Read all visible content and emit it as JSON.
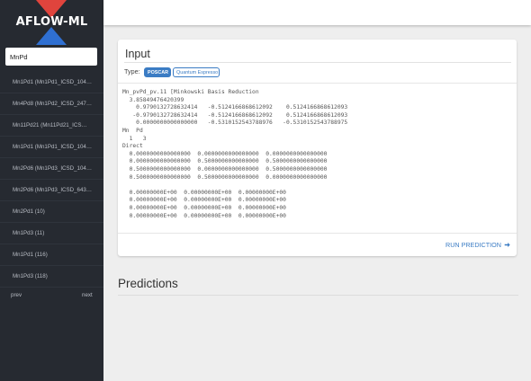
{
  "app": {
    "logo_text": "AFLOW-ML"
  },
  "colors": {
    "sidebar_bg": "#262a31",
    "accent_blue": "#3b7cc4",
    "logo_red": "#e0443d",
    "logo_blue": "#2f6fd1"
  },
  "sidebar": {
    "search_value": "MnPd",
    "items": [
      "Mn1Pd1 (Mn1Pd1_ICSD_104…",
      "Mn4Pd8 (Mn1Pd2_ICSD_247…",
      "Mn11Pd21 (Mn11Pd21_ICS…",
      "Mn1Pd1 (Mn1Pd1_ICSD_104…",
      "Mn2Pd6 (Mn1Pd3_ICSD_104…",
      "Mn2Pd6 (Mn1Pd3_ICSD_643…",
      "Mn2Pd1 (10)",
      "Mn1Pd3 (11)",
      "Mn1Pd1 (116)",
      "Mn1Pd3 (118)"
    ],
    "prev_label": "prev",
    "next_label": "next"
  },
  "input_card": {
    "title": "Input",
    "type_label": "Type:",
    "type_options": {
      "active": "POSCAR",
      "inactive": "Quantum Espresso"
    },
    "content": "Mn_pvPd_pv.11 [Minkowski Basis Reduction\n  3.85849476420399\n    0.9790132728632414   -0.5124166868612092    0.5124166868612093\n   -0.9790132728632414   -0.5124166868612092    0.5124166868612093\n    0.0000000000000000   -0.5310152543788976   -0.5310152543788975\nMn  Pd\n  1   3\nDirect\n  0.0000000000000000  0.0000000000000000  0.0000000000000000\n  0.0000000000000000  0.5000000000000000  0.5000000000000000\n  0.5000000000000000  0.0000000000000000  0.5000000000000000\n  0.5000000000000000  0.5000000000000000  0.0000000000000000\n\n  0.00000000E+00  0.00000000E+00  0.00000000E+00\n  0.00000000E+00  0.00000000E+00  0.00000000E+00\n  0.00000000E+00  0.00000000E+00  0.00000000E+00\n  0.00000000E+00  0.00000000E+00  0.00000000E+00",
    "run_label": "RUN PREDICTION",
    "run_icon": "arrow-right-icon"
  },
  "predictions": {
    "title": "Predictions"
  }
}
